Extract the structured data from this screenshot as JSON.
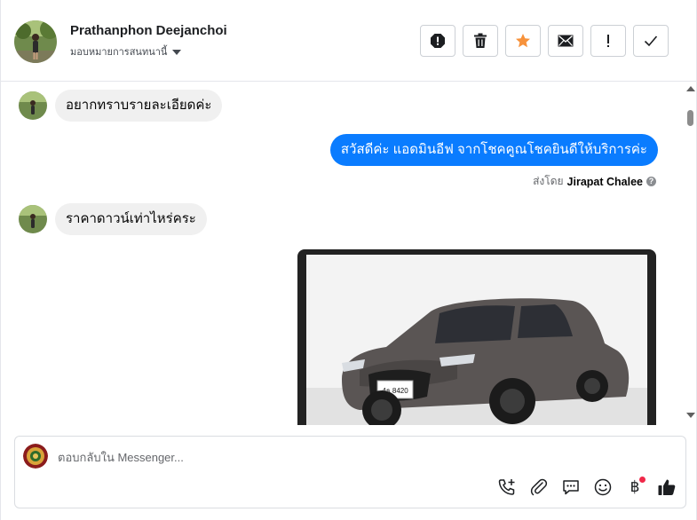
{
  "header": {
    "contact_name": "Prathanphon Deejanchoi",
    "assign_label": "มอบหมายการสนทนานี้"
  },
  "actions": [
    {
      "icon": "alert-circle-icon"
    },
    {
      "icon": "trash-icon"
    },
    {
      "icon": "star-icon",
      "color": "#f7923b"
    },
    {
      "icon": "envelope-icon"
    },
    {
      "icon": "exclamation-icon"
    },
    {
      "icon": "check-icon"
    }
  ],
  "conversation": {
    "messages": [
      {
        "direction": "incoming",
        "text": "อยากทราบรายละเอียดค่ะ"
      },
      {
        "direction": "outgoing",
        "text": "สวัสดีค่ะ แอดมินอีฟ จากโชคคูณโชคยินดีให้บริการค่ะ"
      },
      {
        "direction": "incoming",
        "text": "ราคาดาวน์เท่าไหร่คระ"
      }
    ],
    "sent_by_prefix": "ส่งโดย",
    "sent_by_name": "Jirapat Chalee",
    "help_glyph": "?",
    "photo_caption": "",
    "plate_text": "4ธ 8420"
  },
  "composer": {
    "placeholder": "ตอบกลับใน Messenger...",
    "baht_symbol": "฿"
  },
  "colors": {
    "outgoing_bubble": "#0a7cff",
    "incoming_bubble": "#f0f0f0",
    "star": "#f7923b",
    "notification_dot": "#f02849"
  }
}
